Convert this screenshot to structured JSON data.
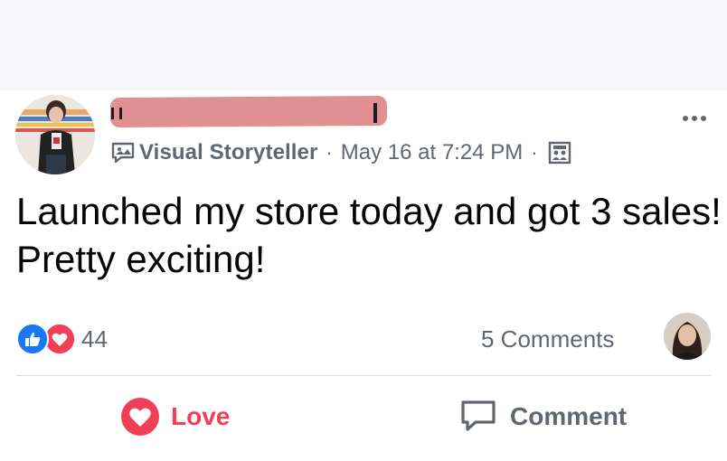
{
  "post": {
    "author_badge": "Visual Storyteller",
    "separator": "·",
    "timestamp": "May 16 at 7:24 PM",
    "separator2": "·",
    "text": "Launched my store today and got 3 sales! Pretty exciting!"
  },
  "reactions": {
    "count": "44",
    "types": [
      "like-icon",
      "love-icon"
    ]
  },
  "comments": {
    "label": "5 Comments"
  },
  "actions": {
    "love_label": "Love",
    "comment_label": "Comment"
  },
  "colors": {
    "love": "#f33e58",
    "like": "#1877f2",
    "muted": "#606770",
    "redaction": "#e09092"
  }
}
